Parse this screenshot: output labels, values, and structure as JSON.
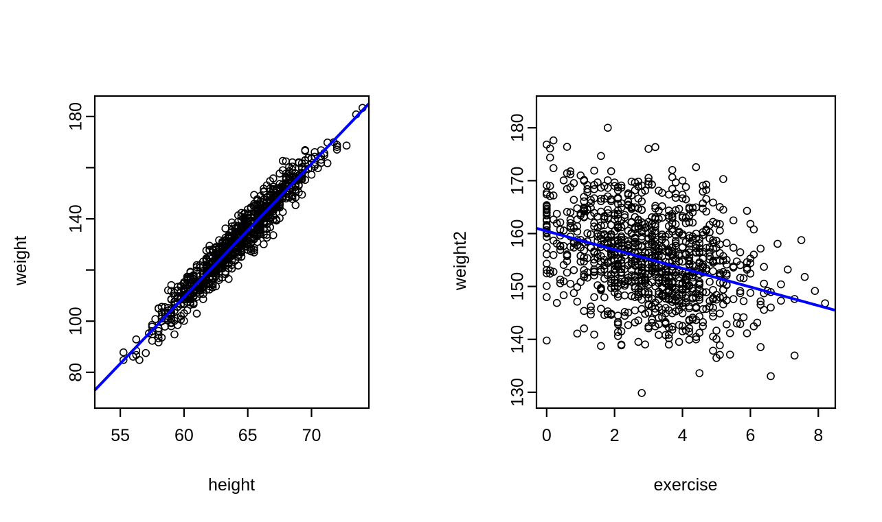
{
  "figure": {
    "background": "#ffffff",
    "layout": "1x2 panel grid of R base-graphics scatterplots",
    "point_color": "#000000",
    "fit_line_color": "#0000FF",
    "axis_color": "#000000"
  },
  "chart_data": [
    {
      "type": "scatter",
      "panel": "left",
      "title": "",
      "xlabel": "height",
      "ylabel": "weight",
      "xlim": [
        53.0,
        74.5
      ],
      "ylim": [
        66.0,
        188.0
      ],
      "xticks": [
        55,
        60,
        65,
        70
      ],
      "xtick_labels": [
        "55",
        "60",
        "65",
        "70"
      ],
      "yticks": [
        80,
        100,
        120,
        140,
        160,
        180
      ],
      "ytick_labels": [
        "80",
        "",
        "100",
        "",
        "140",
        "",
        "180"
      ],
      "ytick_labels_shown": [
        {
          "value": 80,
          "label": "80"
        },
        {
          "value": 100,
          "label": "100"
        },
        {
          "value": 120,
          "label": ""
        },
        {
          "value": 140,
          "label": "140"
        },
        {
          "value": 160,
          "label": ""
        },
        {
          "value": 180,
          "label": "180"
        }
      ],
      "grid": false,
      "legend": "none",
      "n_points": 1000,
      "marker": "open-circle",
      "fit_line": {
        "type": "linear",
        "color": "#0000FF",
        "width": 4,
        "x_start": 53.0,
        "y_start": 73.0,
        "x_end": 74.5,
        "y_end": 185.0,
        "slope": 5.21,
        "intercept": -203.1
      },
      "relationship": "strong positive linear correlation between height and weight",
      "cluster_mean_x": 64.0,
      "cluster_sd_x": 2.9,
      "residual_sd": 4.0
    },
    {
      "type": "scatter",
      "panel": "right",
      "title": "",
      "xlabel": "exercise",
      "ylabel": "weight2",
      "xlim": [
        -0.3,
        8.5
      ],
      "ylim": [
        127.0,
        186.0
      ],
      "xticks": [
        0,
        2,
        4,
        6,
        8
      ],
      "xtick_labels": [
        "0",
        "2",
        "4",
        "6",
        "8"
      ],
      "yticks": [
        130,
        140,
        150,
        160,
        170,
        180
      ],
      "ytick_labels": [
        "130",
        "140",
        "150",
        "160",
        "170",
        "180"
      ],
      "grid": false,
      "legend": "none",
      "n_points": 1000,
      "marker": "open-circle",
      "fit_line": {
        "type": "linear",
        "color": "#0000FF",
        "width": 4,
        "x_start": -0.3,
        "y_start": 161.0,
        "x_end": 8.5,
        "y_end": 145.5,
        "slope": -1.76,
        "intercept": 160.47
      },
      "relationship": "moderate negative linear correlation between exercise and weight2",
      "cluster_mean_x": 3.0,
      "cluster_sd_x": 1.6,
      "residual_sd": 7.3
    }
  ]
}
